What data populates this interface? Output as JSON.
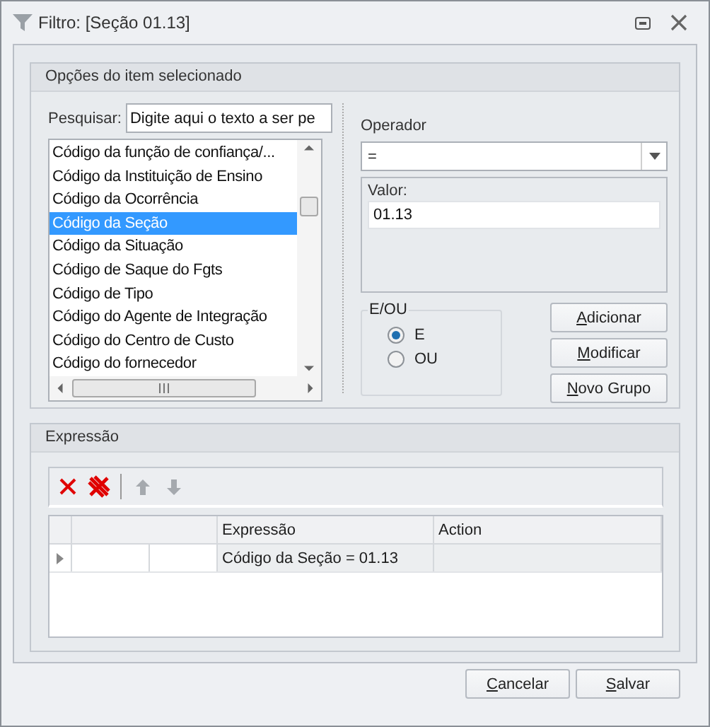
{
  "window": {
    "title": "Filtro: [Seção 01.13]"
  },
  "options_group": {
    "title": "Opções do item selecionado",
    "search": {
      "label": "Pesquisar:",
      "placeholder": "Digite aqui o texto a ser pe"
    },
    "fields": [
      {
        "label": "Código da função de confiança/...",
        "selected": false
      },
      {
        "label": "Código da Instituição de Ensino",
        "selected": false
      },
      {
        "label": "Código da Ocorrência",
        "selected": false
      },
      {
        "label": "Código da Seção",
        "selected": true
      },
      {
        "label": "Código da Situação",
        "selected": false
      },
      {
        "label": "Código de Saque do Fgts",
        "selected": false
      },
      {
        "label": "Código de Tipo",
        "selected": false
      },
      {
        "label": "Código do Agente de Integração",
        "selected": false
      },
      {
        "label": "Código do Centro de Custo",
        "selected": false
      },
      {
        "label": "Código do fornecedor",
        "selected": false
      }
    ],
    "operator": {
      "label": "Operador",
      "value": "="
    },
    "value": {
      "label": "Valor:",
      "value": "01.13"
    },
    "logic": {
      "title": "E/OU",
      "options": [
        {
          "label": "E",
          "selected": true
        },
        {
          "label": "OU",
          "selected": false
        }
      ]
    },
    "buttons": [
      "Adicionar",
      "Modificar",
      "Novo Grupo"
    ]
  },
  "expression_group": {
    "title": "Expressão",
    "toolbar": [
      {
        "kind": "delete",
        "disabled": false
      },
      {
        "kind": "delete-all",
        "disabled": false
      },
      {
        "kind": "up",
        "disabled": true
      },
      {
        "kind": "down",
        "disabled": true
      }
    ],
    "table": {
      "columns": [
        "Expressão",
        "Action"
      ],
      "rows": [
        {
          "selected": true,
          "expression": "Código da Seção = 01.13"
        }
      ]
    }
  },
  "footer_buttons": [
    "Cancelar",
    "Salvar"
  ]
}
